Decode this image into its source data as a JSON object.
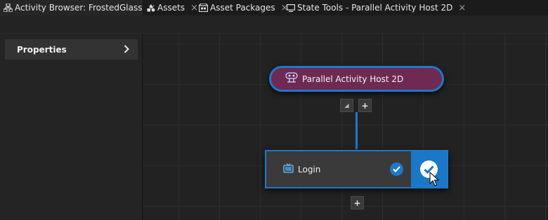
{
  "tabs": [
    {
      "label": "Activity Browser: FrostedGlass",
      "icon": "activity-tree-icon",
      "active": true
    },
    {
      "label": "Assets",
      "icon": "assets-icon",
      "active": false
    },
    {
      "label": "Asset Packages",
      "icon": "asset-packages-icon",
      "active": false
    },
    {
      "label": "State Tools - Parallel Activity Host 2D",
      "icon": "monitor-icon",
      "active": false
    }
  ],
  "close_glyph": "×",
  "properties": {
    "label": "Properties",
    "chevron": "chevron-right-icon"
  },
  "graph": {
    "parallel_node": {
      "label": "Parallel Activity Host 2D",
      "icon": "parallel-host-icon"
    },
    "login_node": {
      "label": "Login",
      "icon": "tv-icon"
    },
    "add_glyph": "+",
    "collapse_glyph": "◢"
  },
  "colors": {
    "accent": "#1f78c8",
    "parallel_fill": "#6e2a52",
    "node_fill": "#3a3a3a"
  }
}
